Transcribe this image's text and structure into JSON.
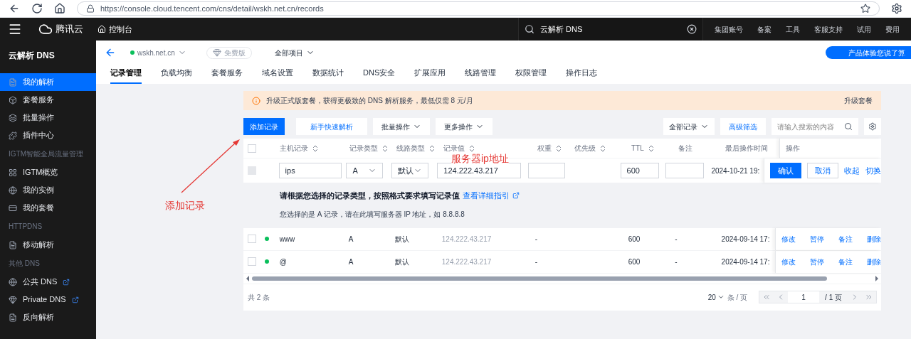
{
  "browser": {
    "url": "https://console.cloud.tencent.com/cns/detail/wskh.net.cn/records"
  },
  "header": {
    "brand": "腾讯云",
    "console": "控制台",
    "search": "云解析 DNS",
    "links": [
      "集团账号",
      "备案",
      "工具",
      "客服支持",
      "试用",
      "费用"
    ]
  },
  "sidebar": {
    "title": "云解析 DNS",
    "sections": [
      {
        "items": [
          {
            "label": "我的解析",
            "selected": true,
            "external": false
          },
          {
            "label": "套餐服务",
            "selected": false,
            "external": false
          },
          {
            "label": "批量操作",
            "selected": false,
            "external": false
          },
          {
            "label": "插件中心",
            "selected": false,
            "external": false
          }
        ]
      },
      {
        "label": "IGTM智能全局流量管理",
        "items": [
          {
            "label": "IGTM概览",
            "selected": false,
            "external": false
          },
          {
            "label": "我的实例",
            "selected": false,
            "external": false
          },
          {
            "label": "我的套餐",
            "selected": false,
            "external": false
          }
        ]
      },
      {
        "label": "HTTPDNS",
        "items": [
          {
            "label": "移动解析",
            "selected": false,
            "external": false
          }
        ]
      },
      {
        "label": "其他 DNS",
        "items": [
          {
            "label": "公共 DNS",
            "selected": false,
            "external": true
          },
          {
            "label": "Private DNS",
            "selected": false,
            "external": true
          },
          {
            "label": "反向解析",
            "selected": false,
            "external": false
          }
        ]
      }
    ]
  },
  "page": {
    "domain": "wskh.net.cn",
    "plan": "免费版",
    "project": "全部项目",
    "feedback": "产品体验您说了算",
    "tabs": [
      {
        "label": "记录管理",
        "selected": true
      },
      {
        "label": "负载均衡",
        "selected": false
      },
      {
        "label": "套餐服务",
        "selected": false
      },
      {
        "label": "域名设置",
        "selected": false
      },
      {
        "label": "数据统计",
        "selected": false
      },
      {
        "label": "DNS安全",
        "selected": false
      },
      {
        "label": "扩展应用",
        "selected": false
      },
      {
        "label": "线路管理",
        "selected": false
      },
      {
        "label": "权限管理",
        "selected": false
      },
      {
        "label": "操作日志",
        "selected": false
      }
    ]
  },
  "alert": {
    "text": "升级正式版套餐，获得更极致的 DNS 解析服务，最低仅需 8 元/月",
    "action": "升级套餐"
  },
  "toolbar": {
    "buttons": [
      {
        "label": "添加记录",
        "kind": "primary"
      },
      {
        "label": "新手快速解析",
        "kind": "link"
      },
      {
        "label": "批量操作",
        "kind": "dropdown"
      },
      {
        "label": "更多操作",
        "kind": "dropdown"
      }
    ],
    "filter": "全部记录",
    "advanced": "高级筛选",
    "search_placeholder": "请输入搜索的内容"
  },
  "table": {
    "select_all_checked": false,
    "columns": [
      {
        "label": "主机记录",
        "sortable": true
      },
      {
        "label": "记录类型",
        "sortable": true
      },
      {
        "label": "线路类型",
        "sortable": true
      },
      {
        "label": "记录值",
        "sortable": true
      },
      {
        "label": "权重",
        "sortable": true
      },
      {
        "label": "优先级",
        "sortable": true
      },
      {
        "label": "TTL",
        "sortable": true
      },
      {
        "label": "备注",
        "sortable": false
      },
      {
        "label": "最后操作时间",
        "sortable": false
      },
      {
        "label": "操作",
        "sortable": false
      }
    ],
    "edit_row": {
      "checked": false,
      "disabled": true,
      "host": "ips",
      "type": "A",
      "line": "默认",
      "value": "124.222.43.217",
      "ttl": "600",
      "time": "2024-10-21 19:",
      "actions": [
        {
          "label": "确认",
          "kind": "primary"
        },
        {
          "label": "取消",
          "kind": "secondary"
        },
        {
          "label": "收起",
          "kind": "link"
        },
        {
          "label": "切换",
          "kind": "link"
        }
      ]
    },
    "hint": {
      "title": "请根据您选择的记录类型，按照格式要求填写记录值",
      "link": "查看详细指引",
      "note": "您选择的是 A 记录，请在此填写服务器 IP 地址，如 8.8.8.8"
    },
    "rows": [
      {
        "checked": false,
        "color": "#0abf5b",
        "host": "www",
        "type": "A",
        "line": "默认",
        "value": "124.222.43.217",
        "weight": "-",
        "ttl": "600",
        "remark": "-",
        "time": "2024-09-14 17:",
        "actions": [
          "修改",
          "暂停",
          "备注",
          "删除"
        ]
      },
      {
        "checked": false,
        "color": "#0abf5b",
        "host": "@",
        "type": "A",
        "line": "默认",
        "value": "124.222.43.217",
        "weight": "-",
        "ttl": "600",
        "remark": "-",
        "time": "2024-09-14 17:",
        "actions": [
          "修改",
          "暂停",
          "备注",
          "删除"
        ]
      }
    ]
  },
  "footer": {
    "total": "共 2 条",
    "page_size": "20",
    "per_page": "条 / 页",
    "page": "1",
    "pages": "/ 1 页"
  },
  "annotations": [
    {
      "kind": "arrow-label",
      "text": "添加记录"
    },
    {
      "kind": "label",
      "text": "服务器ip地址"
    }
  ]
}
